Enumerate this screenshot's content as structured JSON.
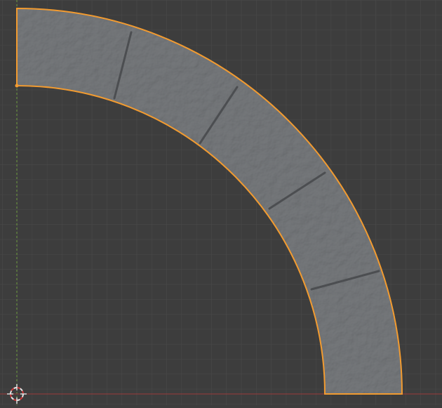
{
  "viewport": {
    "background": "#3d3d3d",
    "grid_minor_color": "#4a4a4a",
    "grid_major_color": "#555555",
    "axis_x_color": "#9c3a3a",
    "axis_y_color": "#6c9a3a"
  },
  "object": {
    "name": "",
    "fill": "#6b6d70",
    "outline": "#f29b30",
    "joint_color": "#4c4e51",
    "selected": true
  },
  "cursor": {
    "icon": "3d-cursor-icon"
  },
  "origin": {
    "icon": "origin-dot-icon",
    "color": "#f29b30"
  }
}
